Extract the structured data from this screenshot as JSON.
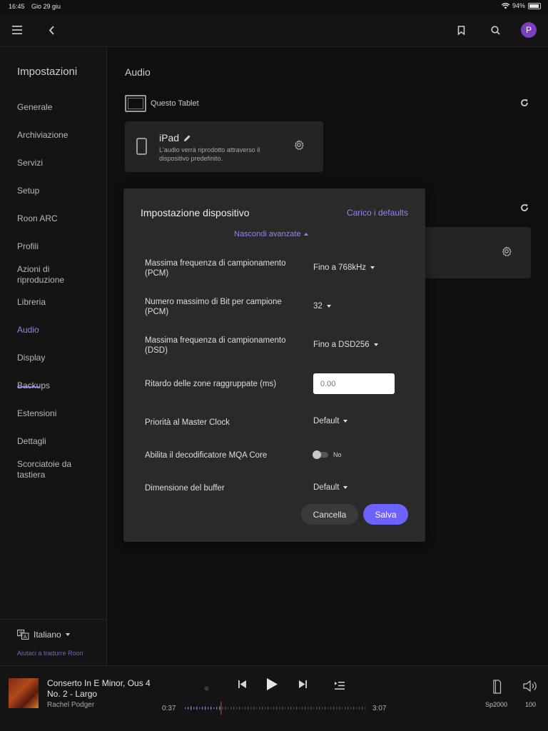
{
  "status_bar": {
    "time": "16:45",
    "date": "Gio 29 giu",
    "battery": "94%",
    "battery_level": 0.94
  },
  "sidebar": {
    "title": "Impostazioni",
    "items": [
      {
        "label": "Generale"
      },
      {
        "label": "Archiviazione"
      },
      {
        "label": "Servizi"
      },
      {
        "label": "Setup"
      },
      {
        "label": "Roon ARC"
      },
      {
        "label": "Profili"
      },
      {
        "label": "Azioni di riproduzione"
      },
      {
        "label": "Libreria"
      },
      {
        "label": "Audio",
        "active": true
      },
      {
        "label": "Display"
      },
      {
        "label": "Backups"
      },
      {
        "label": "Estensioni"
      },
      {
        "label": "Dettagli"
      },
      {
        "label": "Scorciatoie da tastiera"
      }
    ],
    "language": "Italiano",
    "translate_link": "Aiutaci a tradurre Roon"
  },
  "header": {
    "avatar_letter": "P"
  },
  "main": {
    "title": "Audio",
    "section_label": "Questo Tablet",
    "device": {
      "name": "iPad",
      "description": "L'audio verrà riprodotto attraverso il dispositivo predefinito."
    }
  },
  "modal": {
    "title": "Impostazione dispositivo",
    "defaults_link": "Carico i defaults",
    "advanced_toggle": "Nascondi avanzate",
    "rows": {
      "pcm_rate": {
        "label": "Massima frequenza di campionamento (PCM)",
        "value": "Fino a 768kHz"
      },
      "bits": {
        "label": "Numero massimo di Bit per campione (PCM)",
        "value": "32"
      },
      "dsd_rate": {
        "label": "Massima frequenza di campionamento (DSD)",
        "value": "Fino a DSD256"
      },
      "delay": {
        "label": "Ritardo delle zone raggruppate (ms)",
        "placeholder": "0.00"
      },
      "master_clock": {
        "label": "Priorità al Master Clock",
        "value": "Default"
      },
      "mqa": {
        "label": "Abilita il decodificatore MQA Core",
        "value": "No"
      },
      "buffer": {
        "label": "Dimensione del buffer",
        "value": "Default"
      }
    },
    "cancel": "Cancella",
    "save": "Salva"
  },
  "player": {
    "title": "Conserto In E Minor, Ous 4 No. 2 - Largo",
    "artist": "Rachel Podger",
    "elapsed": "0:37",
    "duration": "3:07",
    "progress": 0.2,
    "zone": "Sp2000",
    "volume": "100"
  },
  "colors": {
    "accent": "#6c63ff",
    "link": "#8f87f0",
    "background": "#0f0f0f",
    "panel": "#2a2a2a"
  }
}
